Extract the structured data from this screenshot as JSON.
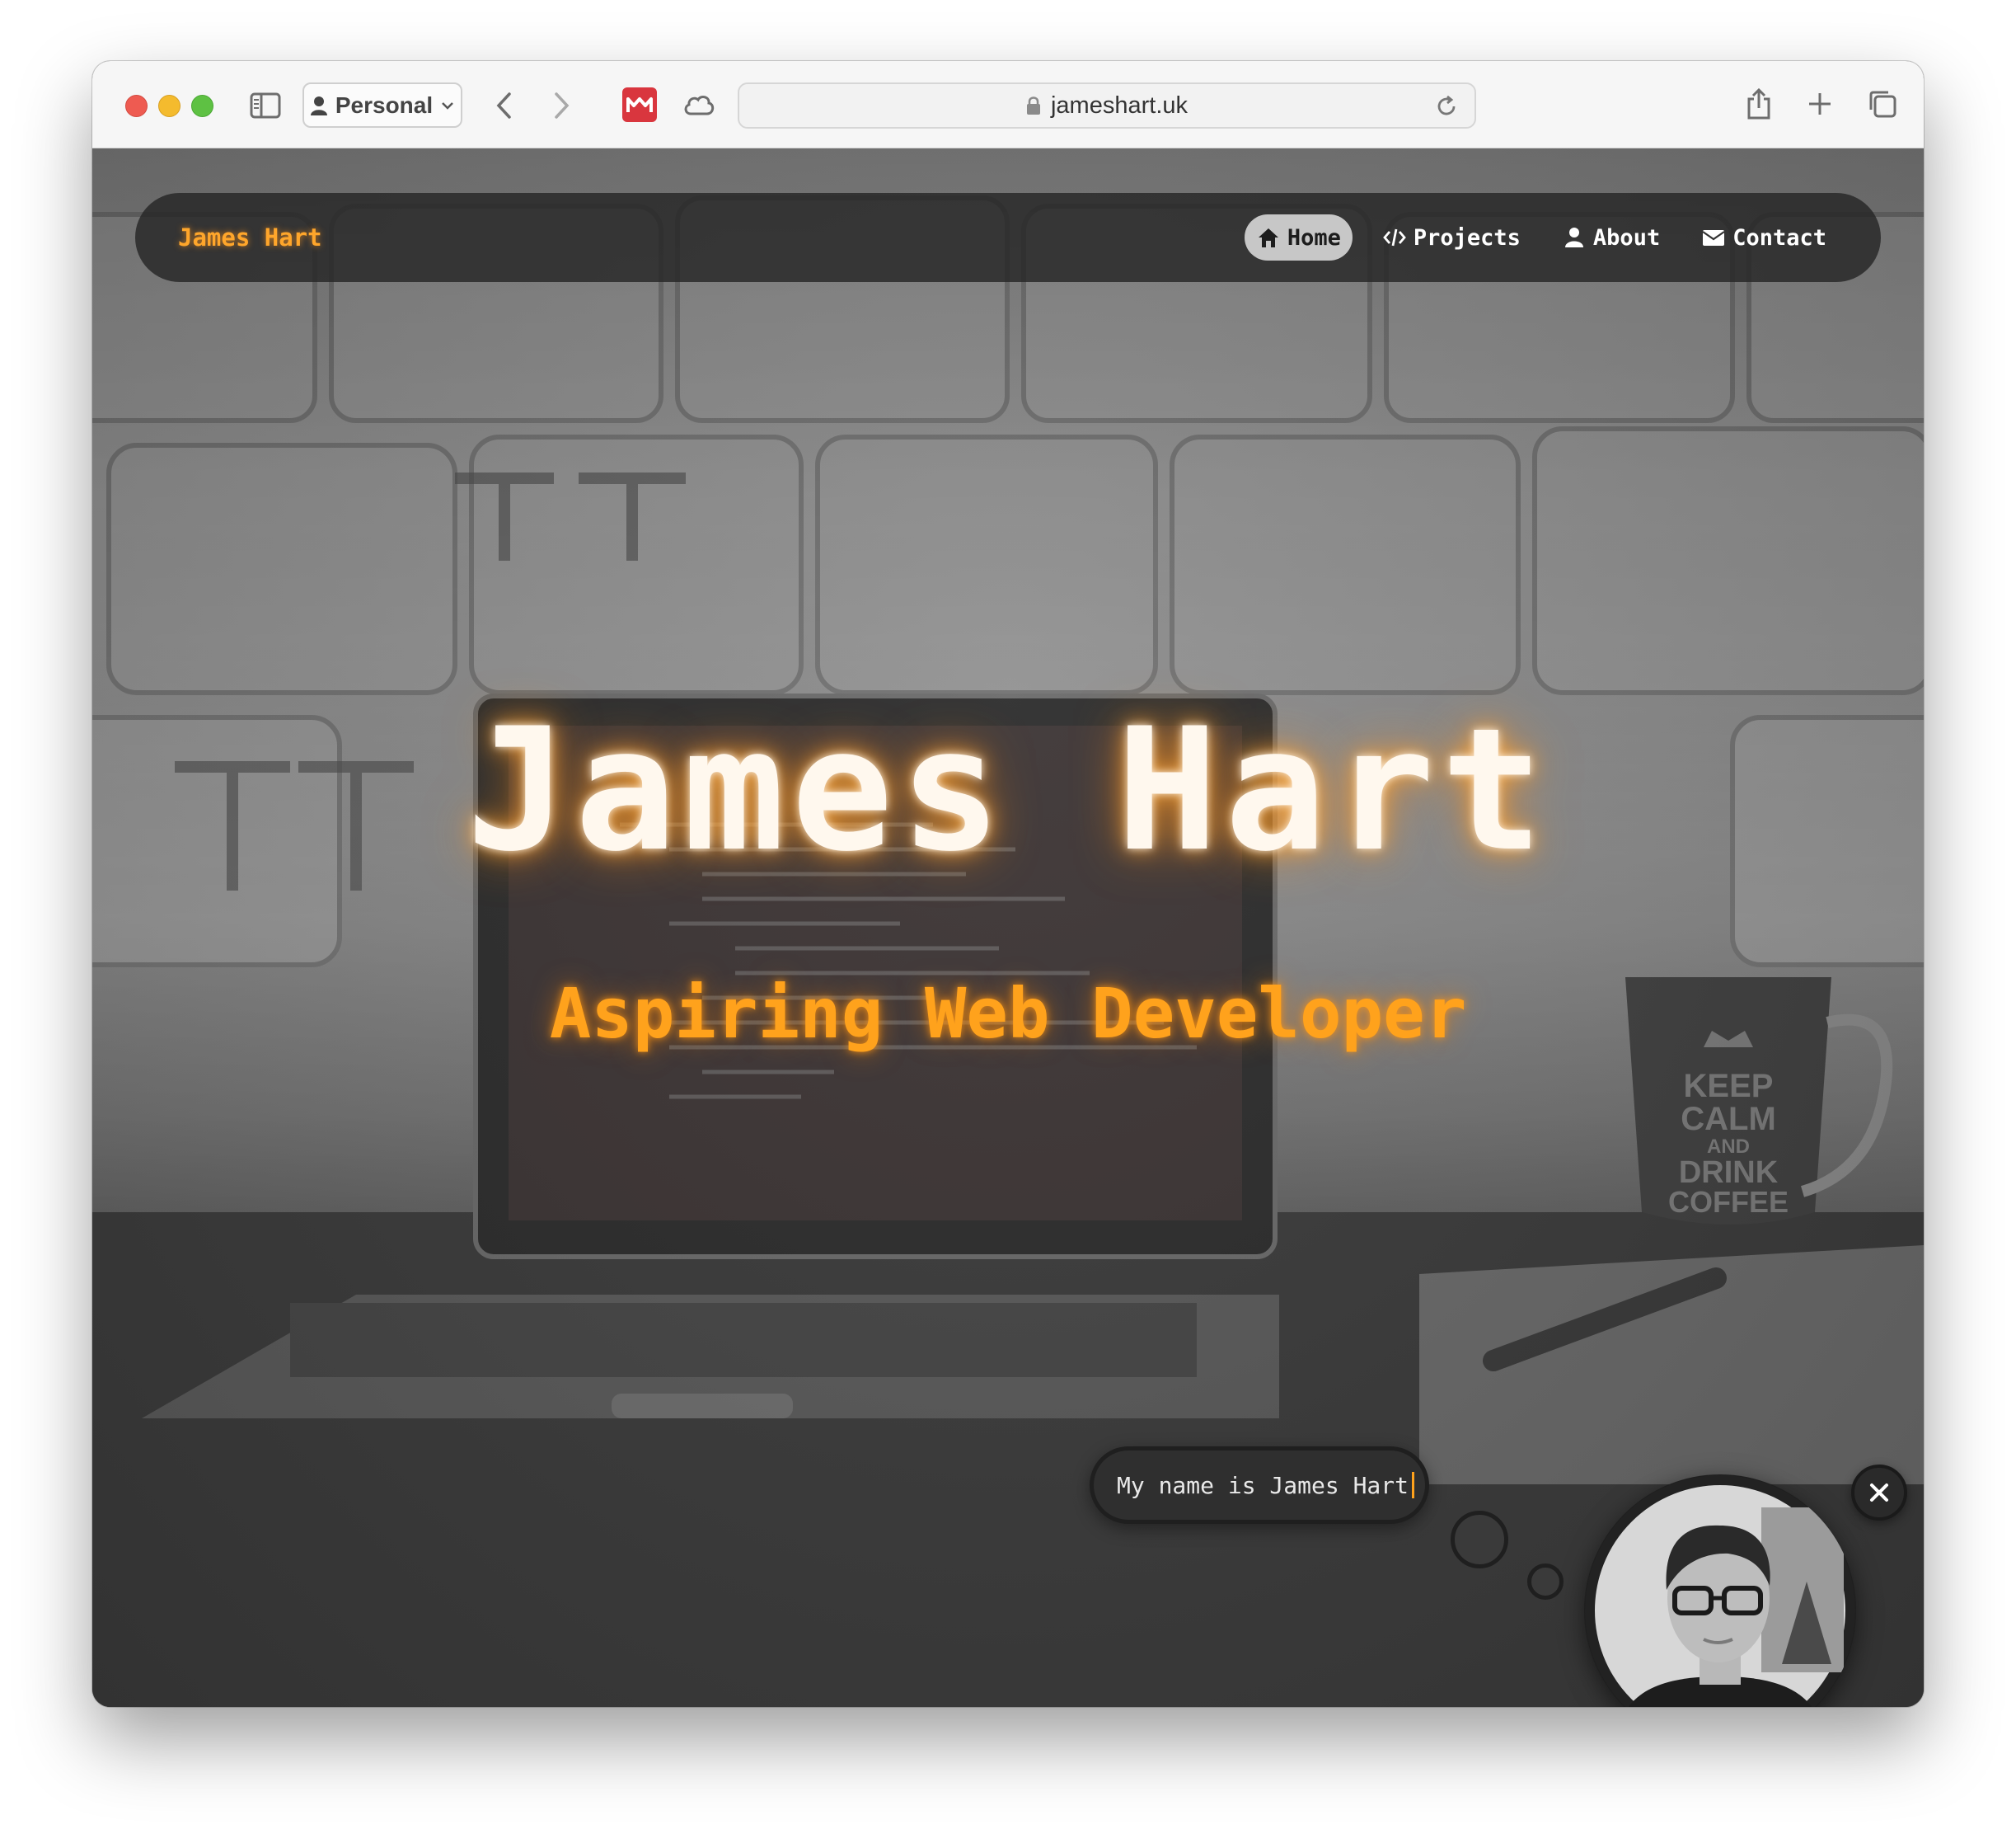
{
  "browser": {
    "profile_label": "Personal",
    "url": "jameshart.uk"
  },
  "site": {
    "brand": "James Hart",
    "nav": [
      {
        "label": "Home",
        "icon": "home-icon",
        "active": true
      },
      {
        "label": "Projects",
        "icon": "code-icon",
        "active": false
      },
      {
        "label": "About",
        "icon": "user-icon",
        "active": false
      },
      {
        "label": "Contact",
        "icon": "envelope-icon",
        "active": false
      }
    ]
  },
  "hero": {
    "title": "James Hart",
    "subtitle": "Aspiring Web Developer"
  },
  "chat": {
    "message": "My name is James Hart"
  },
  "colors": {
    "accent": "#ffa21c",
    "navbar": "#262626",
    "active_pill": "#c7c7c7"
  }
}
